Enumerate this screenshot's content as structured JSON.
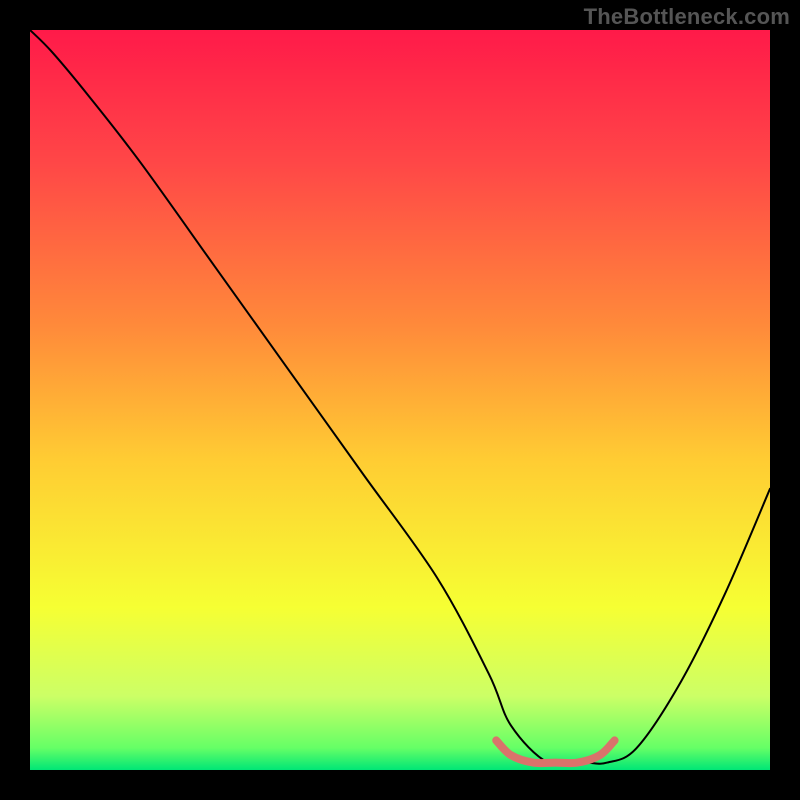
{
  "watermark": "TheBottleneck.com",
  "chart_data": {
    "type": "line",
    "title": "",
    "xlabel": "",
    "ylabel": "",
    "xlim": [
      0,
      100
    ],
    "ylim": [
      0,
      100
    ],
    "grid": false,
    "legend": false,
    "background_gradient": {
      "direction": "vertical",
      "stops": [
        {
          "pos": 0.0,
          "color": "#ff1a49"
        },
        {
          "pos": 0.18,
          "color": "#ff4747"
        },
        {
          "pos": 0.4,
          "color": "#ff8a3a"
        },
        {
          "pos": 0.58,
          "color": "#ffcc33"
        },
        {
          "pos": 0.78,
          "color": "#f6ff33"
        },
        {
          "pos": 0.9,
          "color": "#ccff66"
        },
        {
          "pos": 0.97,
          "color": "#66ff66"
        },
        {
          "pos": 1.0,
          "color": "#00e676"
        }
      ]
    },
    "series": [
      {
        "name": "bottleneck-curve",
        "color": "#000000",
        "width": 2,
        "x": [
          0,
          3,
          8,
          15,
          25,
          35,
          45,
          55,
          62,
          65,
          70,
          75,
          78,
          82,
          88,
          94,
          100
        ],
        "values": [
          100,
          97,
          91,
          82,
          68,
          54,
          40,
          26,
          13,
          6,
          1,
          1,
          1,
          3,
          12,
          24,
          38
        ]
      },
      {
        "name": "highlight-segment",
        "color": "#d9736b",
        "width": 8,
        "x": [
          63,
          65,
          68,
          71,
          74,
          77,
          79
        ],
        "values": [
          4,
          2,
          1,
          1,
          1,
          2,
          4
        ]
      }
    ],
    "annotations": []
  }
}
